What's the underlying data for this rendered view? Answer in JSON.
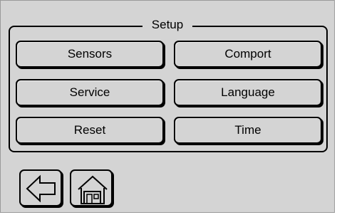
{
  "panel": {
    "title": "Setup"
  },
  "buttons": {
    "sensors": "Sensors",
    "comport": "Comport",
    "service": "Service",
    "language": "Language",
    "reset": "Reset",
    "time": "Time"
  },
  "nav": {
    "back_icon": "left-arrow-icon",
    "home_icon": "home-icon"
  }
}
